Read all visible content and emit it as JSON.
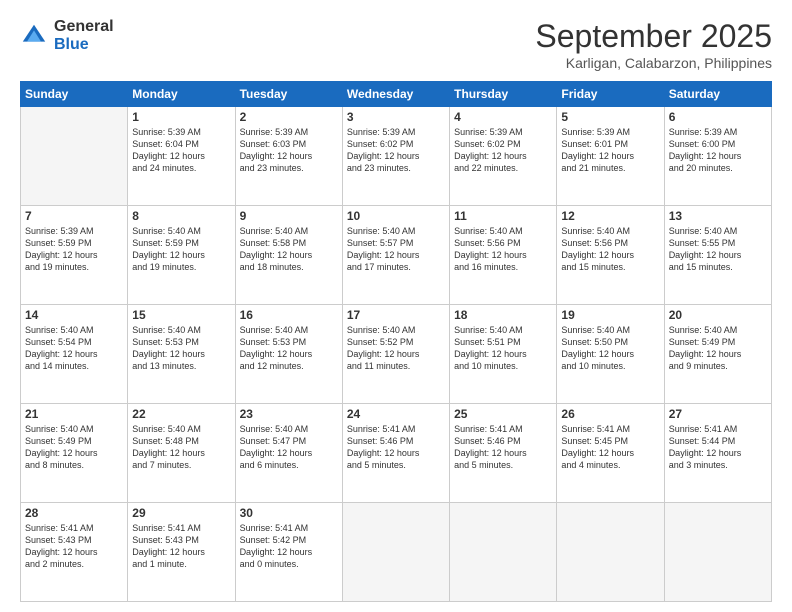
{
  "logo": {
    "general": "General",
    "blue": "Blue"
  },
  "title": "September 2025",
  "subtitle": "Karligan, Calabarzon, Philippines",
  "days": [
    "Sunday",
    "Monday",
    "Tuesday",
    "Wednesday",
    "Thursday",
    "Friday",
    "Saturday"
  ],
  "weeks": [
    [
      {
        "num": "",
        "info": ""
      },
      {
        "num": "1",
        "info": "Sunrise: 5:39 AM\nSunset: 6:04 PM\nDaylight: 12 hours\nand 24 minutes."
      },
      {
        "num": "2",
        "info": "Sunrise: 5:39 AM\nSunset: 6:03 PM\nDaylight: 12 hours\nand 23 minutes."
      },
      {
        "num": "3",
        "info": "Sunrise: 5:39 AM\nSunset: 6:02 PM\nDaylight: 12 hours\nand 23 minutes."
      },
      {
        "num": "4",
        "info": "Sunrise: 5:39 AM\nSunset: 6:02 PM\nDaylight: 12 hours\nand 22 minutes."
      },
      {
        "num": "5",
        "info": "Sunrise: 5:39 AM\nSunset: 6:01 PM\nDaylight: 12 hours\nand 21 minutes."
      },
      {
        "num": "6",
        "info": "Sunrise: 5:39 AM\nSunset: 6:00 PM\nDaylight: 12 hours\nand 20 minutes."
      }
    ],
    [
      {
        "num": "7",
        "info": "Sunrise: 5:39 AM\nSunset: 5:59 PM\nDaylight: 12 hours\nand 19 minutes."
      },
      {
        "num": "8",
        "info": "Sunrise: 5:40 AM\nSunset: 5:59 PM\nDaylight: 12 hours\nand 19 minutes."
      },
      {
        "num": "9",
        "info": "Sunrise: 5:40 AM\nSunset: 5:58 PM\nDaylight: 12 hours\nand 18 minutes."
      },
      {
        "num": "10",
        "info": "Sunrise: 5:40 AM\nSunset: 5:57 PM\nDaylight: 12 hours\nand 17 minutes."
      },
      {
        "num": "11",
        "info": "Sunrise: 5:40 AM\nSunset: 5:56 PM\nDaylight: 12 hours\nand 16 minutes."
      },
      {
        "num": "12",
        "info": "Sunrise: 5:40 AM\nSunset: 5:56 PM\nDaylight: 12 hours\nand 15 minutes."
      },
      {
        "num": "13",
        "info": "Sunrise: 5:40 AM\nSunset: 5:55 PM\nDaylight: 12 hours\nand 15 minutes."
      }
    ],
    [
      {
        "num": "14",
        "info": "Sunrise: 5:40 AM\nSunset: 5:54 PM\nDaylight: 12 hours\nand 14 minutes."
      },
      {
        "num": "15",
        "info": "Sunrise: 5:40 AM\nSunset: 5:53 PM\nDaylight: 12 hours\nand 13 minutes."
      },
      {
        "num": "16",
        "info": "Sunrise: 5:40 AM\nSunset: 5:53 PM\nDaylight: 12 hours\nand 12 minutes."
      },
      {
        "num": "17",
        "info": "Sunrise: 5:40 AM\nSunset: 5:52 PM\nDaylight: 12 hours\nand 11 minutes."
      },
      {
        "num": "18",
        "info": "Sunrise: 5:40 AM\nSunset: 5:51 PM\nDaylight: 12 hours\nand 10 minutes."
      },
      {
        "num": "19",
        "info": "Sunrise: 5:40 AM\nSunset: 5:50 PM\nDaylight: 12 hours\nand 10 minutes."
      },
      {
        "num": "20",
        "info": "Sunrise: 5:40 AM\nSunset: 5:49 PM\nDaylight: 12 hours\nand 9 minutes."
      }
    ],
    [
      {
        "num": "21",
        "info": "Sunrise: 5:40 AM\nSunset: 5:49 PM\nDaylight: 12 hours\nand 8 minutes."
      },
      {
        "num": "22",
        "info": "Sunrise: 5:40 AM\nSunset: 5:48 PM\nDaylight: 12 hours\nand 7 minutes."
      },
      {
        "num": "23",
        "info": "Sunrise: 5:40 AM\nSunset: 5:47 PM\nDaylight: 12 hours\nand 6 minutes."
      },
      {
        "num": "24",
        "info": "Sunrise: 5:41 AM\nSunset: 5:46 PM\nDaylight: 12 hours\nand 5 minutes."
      },
      {
        "num": "25",
        "info": "Sunrise: 5:41 AM\nSunset: 5:46 PM\nDaylight: 12 hours\nand 5 minutes."
      },
      {
        "num": "26",
        "info": "Sunrise: 5:41 AM\nSunset: 5:45 PM\nDaylight: 12 hours\nand 4 minutes."
      },
      {
        "num": "27",
        "info": "Sunrise: 5:41 AM\nSunset: 5:44 PM\nDaylight: 12 hours\nand 3 minutes."
      }
    ],
    [
      {
        "num": "28",
        "info": "Sunrise: 5:41 AM\nSunset: 5:43 PM\nDaylight: 12 hours\nand 2 minutes."
      },
      {
        "num": "29",
        "info": "Sunrise: 5:41 AM\nSunset: 5:43 PM\nDaylight: 12 hours\nand 1 minute."
      },
      {
        "num": "30",
        "info": "Sunrise: 5:41 AM\nSunset: 5:42 PM\nDaylight: 12 hours\nand 0 minutes."
      },
      {
        "num": "",
        "info": ""
      },
      {
        "num": "",
        "info": ""
      },
      {
        "num": "",
        "info": ""
      },
      {
        "num": "",
        "info": ""
      }
    ]
  ]
}
